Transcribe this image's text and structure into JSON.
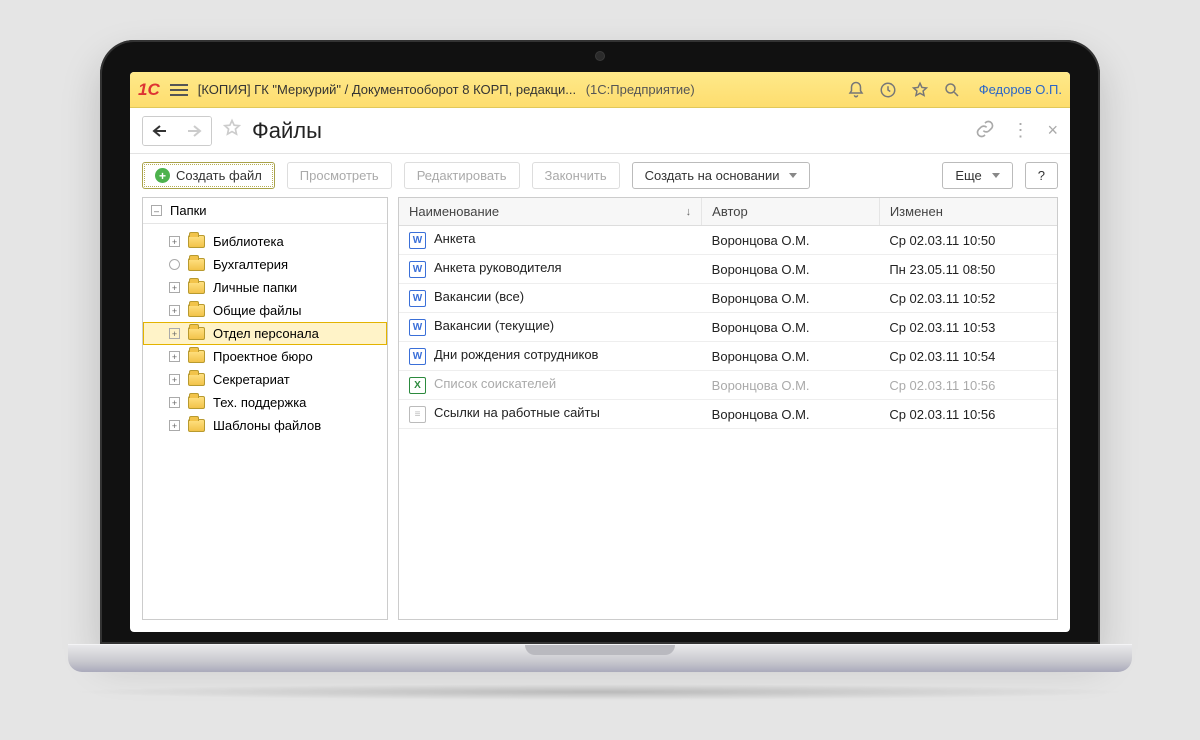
{
  "titlebar": {
    "title": "[КОПИЯ] ГК \"Меркурий\" / Документооборот 8 КОРП, редакци...",
    "app_hint": "(1С:Предприятие)",
    "user": "Федоров О.П."
  },
  "subheader": {
    "page_title": "Файлы"
  },
  "toolbar": {
    "create_file": "Создать файл",
    "view": "Просмотреть",
    "edit": "Редактировать",
    "finish": "Закончить",
    "create_based_on": "Создать на основании",
    "more": "Еще",
    "help": "?"
  },
  "tree": {
    "root_label": "Папки",
    "items": [
      {
        "label": "Библиотека",
        "selected": false
      },
      {
        "label": "Бухгалтерия",
        "selected": false
      },
      {
        "label": "Личные папки",
        "selected": false
      },
      {
        "label": "Общие файлы",
        "selected": false
      },
      {
        "label": "Отдел персонала",
        "selected": true
      },
      {
        "label": "Проектное бюро",
        "selected": false
      },
      {
        "label": "Секретариат",
        "selected": false
      },
      {
        "label": "Тех. поддержка",
        "selected": false
      },
      {
        "label": "Шаблоны файлов",
        "selected": false
      }
    ]
  },
  "grid": {
    "columns": {
      "name": "Наименование",
      "author": "Автор",
      "modified": "Изменен"
    },
    "rows": [
      {
        "type": "word",
        "name": "Анкета",
        "author": "Воронцова О.М.",
        "modified": "Ср 02.03.11 10:50",
        "dim": false
      },
      {
        "type": "word",
        "name": "Анкета руководителя",
        "author": "Воронцова О.М.",
        "modified": "Пн 23.05.11 08:50",
        "dim": false
      },
      {
        "type": "word",
        "name": "Вакансии (все)",
        "author": "Воронцова О.М.",
        "modified": "Ср 02.03.11 10:52",
        "dim": false
      },
      {
        "type": "word",
        "name": "Вакансии (текущие)",
        "author": "Воронцова О.М.",
        "modified": "Ср 02.03.11 10:53",
        "dim": false
      },
      {
        "type": "word",
        "name": "Дни рождения сотрудников",
        "author": "Воронцова О.М.",
        "modified": "Ср 02.03.11 10:54",
        "dim": false
      },
      {
        "type": "excel",
        "name": "Список соискателей",
        "author": "Воронцова О.М.",
        "modified": "Ср 02.03.11 10:56",
        "dim": true
      },
      {
        "type": "text",
        "name": "Ссылки на работные сайты",
        "author": "Воронцова О.М.",
        "modified": "Ср 02.03.11 10:56",
        "dim": false
      }
    ]
  }
}
